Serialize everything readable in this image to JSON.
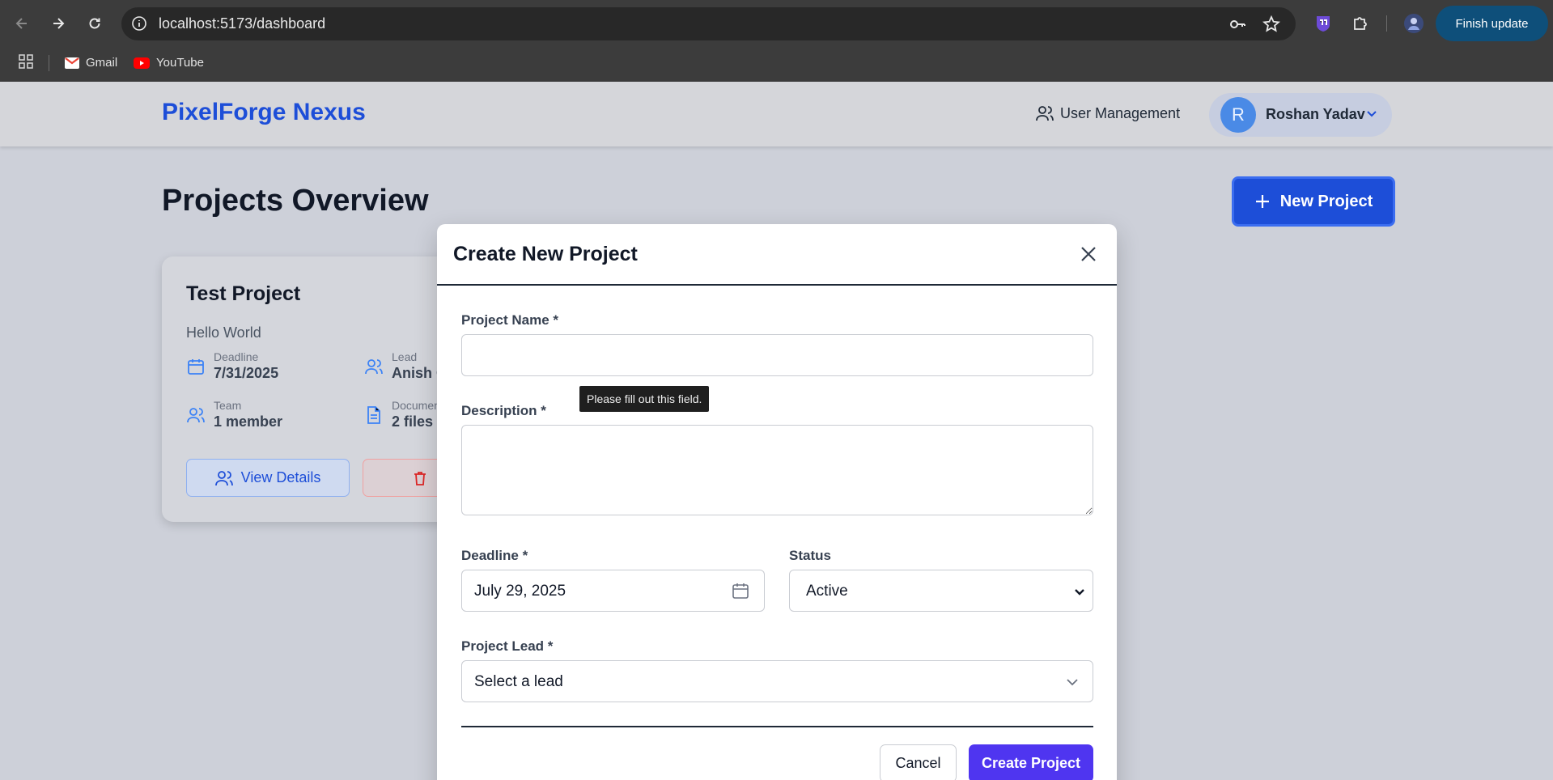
{
  "browser": {
    "url": "localhost:5173/dashboard",
    "finish_update_label": "Finish update",
    "bookmarks": [
      {
        "label": "Gmail",
        "icon": "gmail-icon"
      },
      {
        "label": "YouTube",
        "icon": "youtube-icon"
      }
    ]
  },
  "header": {
    "brand": "PixelForge Nexus",
    "user_management_label": "User Management",
    "user": {
      "initial": "R",
      "name": "Roshan Yadav"
    }
  },
  "main": {
    "title": "Projects Overview",
    "new_project_label": "New Project",
    "project_card": {
      "title": "Test Project",
      "description": "Hello World",
      "deadline_label": "Deadline",
      "deadline_value": "7/31/2025",
      "lead_label": "Lead",
      "lead_value": "Anish G",
      "team_label": "Team",
      "team_value": "1 member",
      "documents_label": "Documents",
      "documents_value": "2 files",
      "view_details_label": "View Details"
    }
  },
  "modal": {
    "title": "Create New Project",
    "project_name_label": "Project Name *",
    "project_name_value": "",
    "tooltip": "Please fill out this field.",
    "description_label": "Description *",
    "description_value": "",
    "deadline_label": "Deadline *",
    "deadline_value": "July 29, 2025",
    "status_label": "Status",
    "status_value": "Active",
    "project_lead_label": "Project Lead *",
    "project_lead_placeholder": "Select a lead",
    "cancel_label": "Cancel",
    "create_label": "Create Project"
  },
  "colors": {
    "brand": "#1d4ed8",
    "primary_button": "#1d4ed8",
    "create_button": "#4f35f0",
    "avatar": "#4a8ae6",
    "finish_update": "#0e4f7a"
  }
}
